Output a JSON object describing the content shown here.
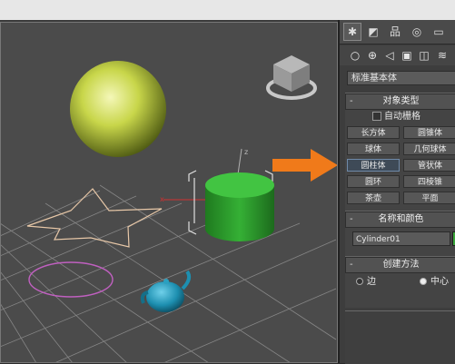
{
  "command_panel": {
    "tab_icons": [
      "create-icon",
      "modify-icon",
      "hierarchy-icon",
      "motion-icon",
      "display-icon"
    ],
    "subtab_icons": [
      "geometry-icon",
      "shapes-icon",
      "lights-icon",
      "cameras-icon",
      "helpers-icon",
      "space-warps-icon"
    ],
    "category_dropdown": "标准基本体",
    "object_type": {
      "title": "对象类型",
      "autogrid_label": "自动栅格",
      "buttons": [
        "长方体",
        "圆锥体",
        "球体",
        "几何球体",
        "圆柱体",
        "管状体",
        "圆环",
        "四棱锥",
        "茶壶",
        "平面"
      ],
      "selected": "圆柱体"
    },
    "name_and_color": {
      "title": "名称和颜色",
      "name_value": "Cylinder01",
      "color": "#3aa43a"
    },
    "creation_method": {
      "title": "创建方法",
      "options": [
        "边",
        "中心"
      ],
      "selected": "中心"
    }
  },
  "colors": {
    "arrow": "#f07a1a",
    "sphere": "#c8d64a",
    "cylinder": "#3fbf3f",
    "teapot": "#1d8fb0",
    "star_outline": "#e8c8a8",
    "circle_outline": "#c060c0"
  },
  "viewport": {
    "grid": true,
    "objects": [
      "sphere",
      "star",
      "cylinder",
      "circle",
      "teapot"
    ]
  }
}
